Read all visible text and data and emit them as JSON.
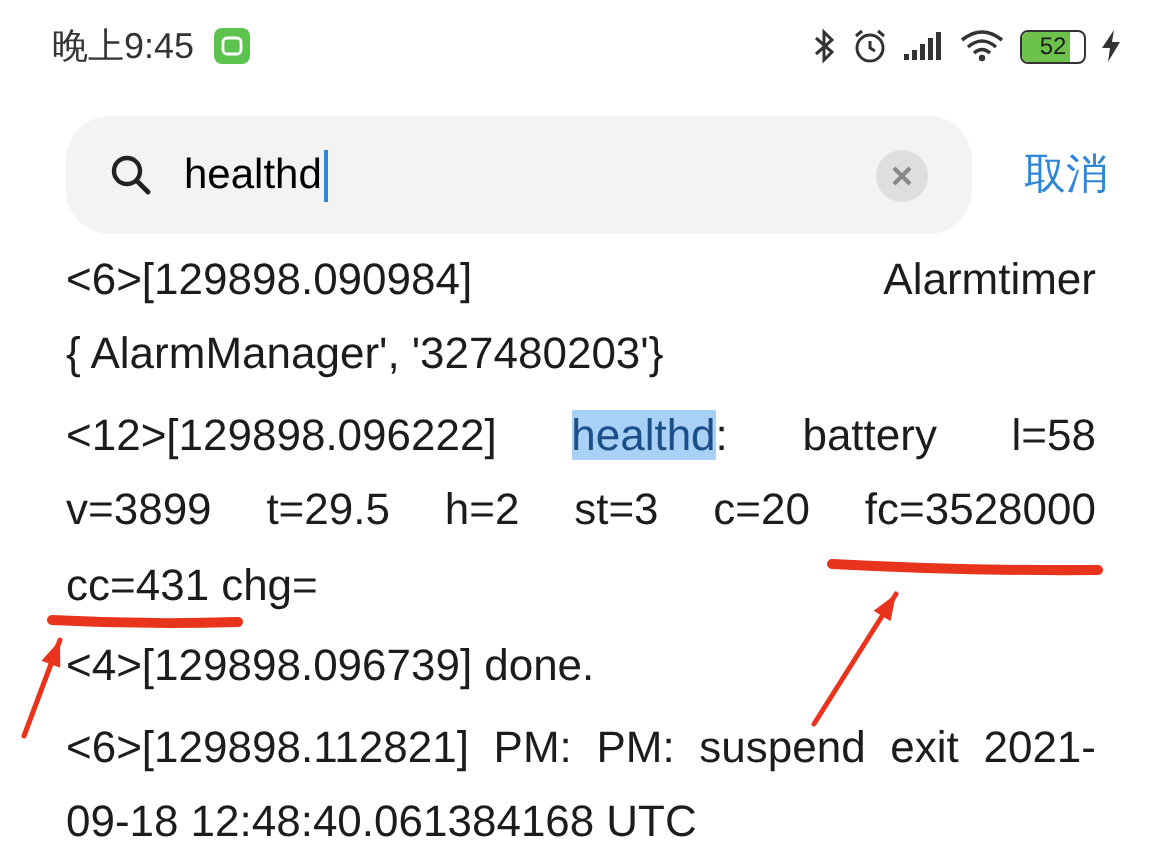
{
  "status_bar": {
    "time": "晚上9:45",
    "battery": "52"
  },
  "search": {
    "value": "healthd",
    "cancel": "取消"
  },
  "log_entries": [
    {
      "lines": [
        {
          "justified": true,
          "words": [
            "<6>[129898.090984]",
            "Alarmtimer"
          ]
        },
        {
          "justified": false,
          "words": [
            "{ AlarmManager',",
            "'327480203'}"
          ]
        }
      ]
    },
    {
      "lines": [
        {
          "justified": true,
          "words": [
            "<12>[129898.096222]",
            {
              "parts": [
                {
                  "text": "healthd",
                  "highlighted": true
                },
                {
                  "text": ":",
                  "highlighted": false
                }
              ]
            },
            "battery",
            "l=58"
          ]
        },
        {
          "justified": true,
          "words": [
            "v=3899",
            "t=29.5",
            "h=2",
            "st=3",
            "c=20",
            "fc=3528000"
          ]
        },
        {
          "justified": false,
          "words": [
            "cc=431",
            "chg="
          ]
        }
      ]
    },
    {
      "lines": [
        {
          "justified": false,
          "words": [
            "<4>[129898.096739]",
            "done."
          ]
        }
      ]
    },
    {
      "lines": [
        {
          "justified": true,
          "words": [
            "<6>[129898.112821]",
            "PM:",
            "PM:",
            "suspend",
            "exit",
            "2021-"
          ]
        },
        {
          "justified": false,
          "words": [
            "09-18",
            "12:48:40.061384168",
            "UTC"
          ]
        }
      ]
    }
  ],
  "annotations": [
    {
      "kind": "underline"
    },
    {
      "kind": "underline"
    },
    {
      "kind": "arrow"
    },
    {
      "kind": "arrow"
    }
  ]
}
